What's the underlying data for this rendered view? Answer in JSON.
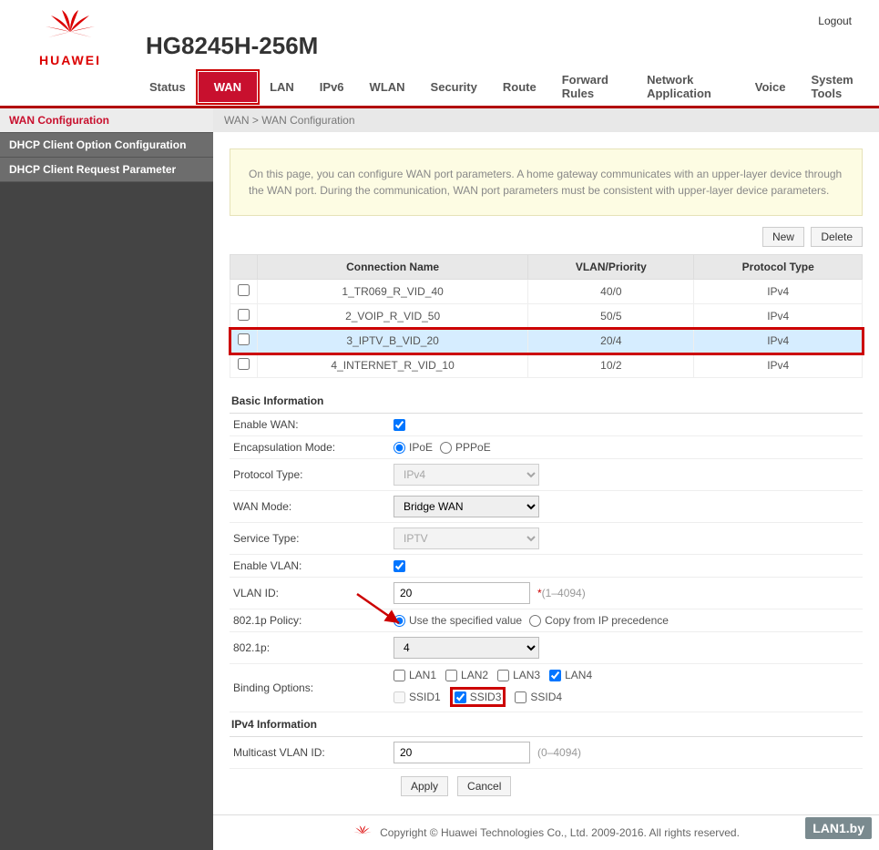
{
  "brand": "HUAWEI",
  "model": "HG8245H-256M",
  "logout": "Logout",
  "nav": {
    "items": [
      {
        "label": "Status"
      },
      {
        "label": "WAN",
        "active": true
      },
      {
        "label": "LAN"
      },
      {
        "label": "IPv6"
      },
      {
        "label": "WLAN"
      },
      {
        "label": "Security"
      },
      {
        "label": "Route"
      },
      {
        "label": "Forward Rules"
      },
      {
        "label": "Network Application"
      },
      {
        "label": "Voice"
      },
      {
        "label": "System Tools"
      }
    ]
  },
  "sidebar": {
    "items": [
      {
        "label": "WAN Configuration",
        "active": true
      },
      {
        "label": "DHCP Client Option Configuration"
      },
      {
        "label": "DHCP Client Request Parameter"
      }
    ]
  },
  "breadcrumb": "WAN > WAN Configuration",
  "info_text": "On this page, you can configure WAN port parameters. A home gateway communicates with an upper-layer device through the WAN port. During the communication, WAN port parameters must be consistent with upper-layer device parameters.",
  "toolbar": {
    "new": "New",
    "delete": "Delete"
  },
  "table": {
    "headers": {
      "name": "Connection Name",
      "vlan": "VLAN/Priority",
      "proto": "Protocol Type"
    },
    "rows": [
      {
        "name": "1_TR069_R_VID_40",
        "vlan": "40/0",
        "proto": "IPv4"
      },
      {
        "name": "2_VOIP_R_VID_50",
        "vlan": "50/5",
        "proto": "IPv4"
      },
      {
        "name": "3_IPTV_B_VID_20",
        "vlan": "20/4",
        "proto": "IPv4",
        "selected": true
      },
      {
        "name": "4_INTERNET_R_VID_10",
        "vlan": "10/2",
        "proto": "IPv4"
      }
    ]
  },
  "basic": {
    "title": "Basic Information",
    "enable_wan": {
      "label": "Enable WAN:",
      "checked": true
    },
    "encap": {
      "label": "Encapsulation Mode:",
      "options": [
        "IPoE",
        "PPPoE"
      ],
      "value": "IPoE"
    },
    "proto": {
      "label": "Protocol Type:",
      "value": "IPv4"
    },
    "wan_mode": {
      "label": "WAN Mode:",
      "value": "Bridge WAN"
    },
    "service": {
      "label": "Service Type:",
      "value": "IPTV"
    },
    "enable_vlan": {
      "label": "Enable VLAN:",
      "checked": true
    },
    "vlan_id": {
      "label": "VLAN ID:",
      "value": "20",
      "hint": "(1–4094)"
    },
    "policy": {
      "label": "802.1p Policy:",
      "opt1": "Use the specified value",
      "opt2": "Copy from IP precedence",
      "value": "specified"
    },
    "p8021": {
      "label": "802.1p:",
      "value": "4"
    },
    "binding": {
      "label": "Binding Options:",
      "lan": [
        {
          "label": "LAN1",
          "checked": false
        },
        {
          "label": "LAN2",
          "checked": false
        },
        {
          "label": "LAN3",
          "checked": false
        },
        {
          "label": "LAN4",
          "checked": true
        }
      ],
      "ssid": [
        {
          "label": "SSID1",
          "checked": false
        },
        {
          "label": "SSID3",
          "checked": true,
          "highlight": true
        },
        {
          "label": "SSID4",
          "checked": false
        }
      ]
    }
  },
  "ipv4": {
    "title": "IPv4 Information",
    "multicast": {
      "label": "Multicast VLAN ID:",
      "value": "20",
      "hint": "(0–4094)"
    }
  },
  "actions": {
    "apply": "Apply",
    "cancel": "Cancel"
  },
  "footer": "Copyright © Huawei Technologies Co., Ltd. 2009-2016. All rights reserved.",
  "watermark": "LAN1.by"
}
